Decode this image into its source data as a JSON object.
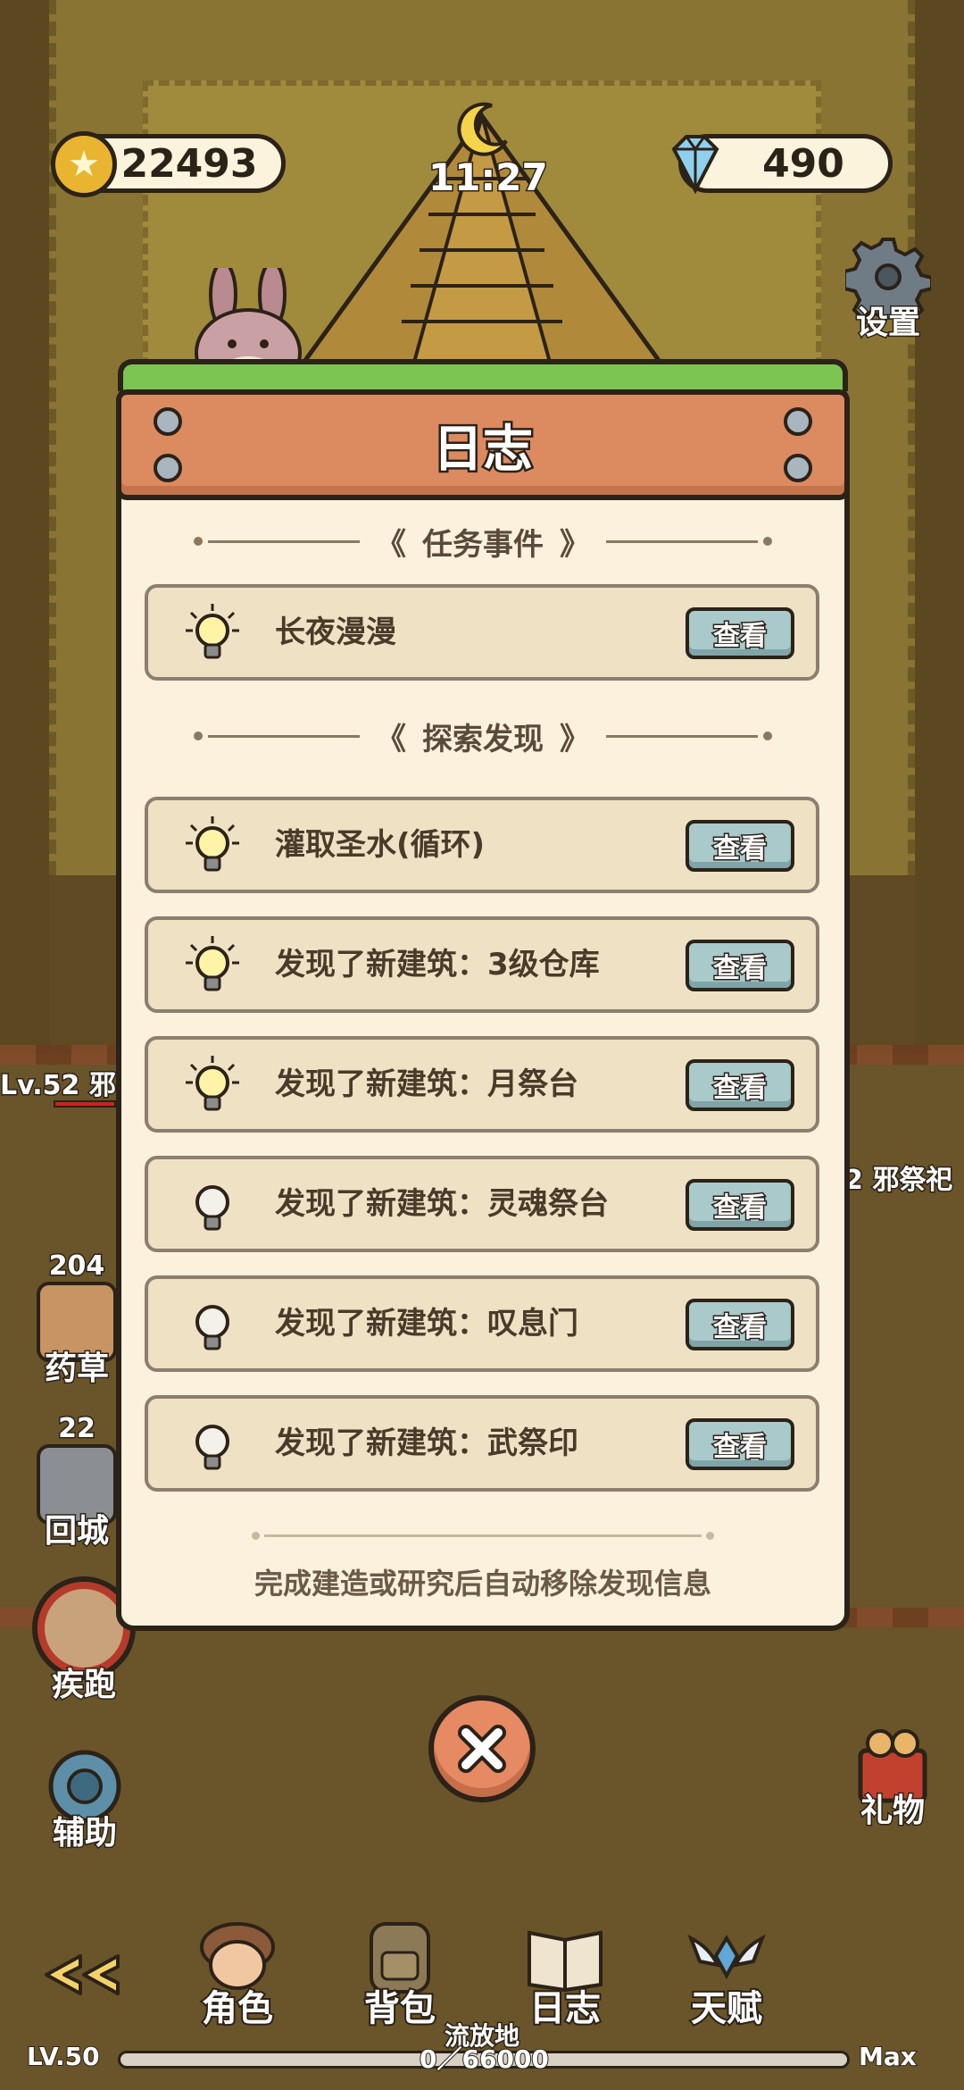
{
  "hud": {
    "coins": "22493",
    "gems": "490",
    "time": "11:27",
    "settings_label": "设置"
  },
  "side": {
    "herb_count": "204",
    "herb_label": "药草",
    "town_count": "22",
    "town_label": "回城",
    "sprint_label": "疾跑",
    "assist_label": "辅助",
    "gift_label": "礼物"
  },
  "enemies": {
    "left_label": "Lv.52 邪",
    "right_label": "2 邪祭祀"
  },
  "modal": {
    "title": "日志",
    "section_tasks": "任务事件",
    "section_discoveries": "探索发现",
    "tasks": [
      {
        "text": "长夜漫漫",
        "lit": true,
        "button": "查看"
      }
    ],
    "discoveries": [
      {
        "text": "灌取圣水(循环)",
        "lit": true,
        "button": "查看"
      },
      {
        "text": "发现了新建筑：3级仓库",
        "lit": true,
        "button": "查看"
      },
      {
        "text": "发现了新建筑：月祭台",
        "lit": true,
        "button": "查看"
      },
      {
        "text": "发现了新建筑：灵魂祭台",
        "lit": false,
        "button": "查看"
      },
      {
        "text": "发现了新建筑：叹息门",
        "lit": false,
        "button": "查看"
      },
      {
        "text": "发现了新建筑：武祭印",
        "lit": false,
        "button": "查看"
      }
    ],
    "footer_note": "完成建造或研究后自动移除发现信息"
  },
  "nav": {
    "role": "角色",
    "bag": "背包",
    "log": "日志",
    "talent": "天赋",
    "exile": "流放地"
  },
  "level": {
    "lv": "LV.50",
    "xp": "0／66000",
    "max": "Max",
    "xp_progress": 0
  },
  "colors": {
    "panel": "#fbf1dd",
    "header": "#dc8a60",
    "view_button": "#a9c9cb",
    "outline": "#2b2218"
  },
  "icons": {
    "coin": "coin-icon",
    "gem": "diamond-icon",
    "moon": "moon-icon",
    "settings": "gear-icon",
    "bulb_lit": "lightbulb-lit-icon",
    "bulb_off": "lightbulb-off-icon",
    "close": "close-icon"
  }
}
